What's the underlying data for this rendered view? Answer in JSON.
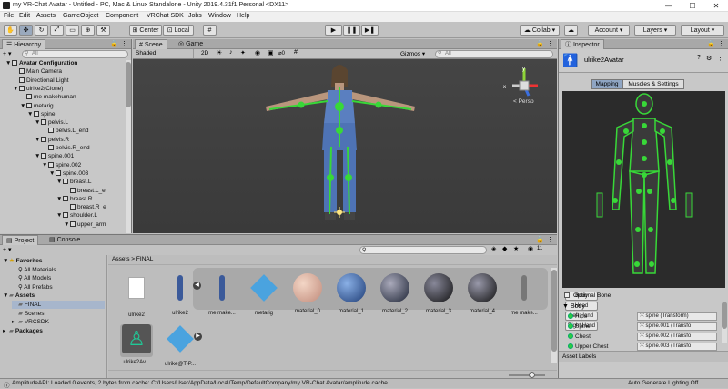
{
  "window": {
    "title": "my VR-Chat Avatar - Untitled - PC, Mac & Linux Standalone - Unity 2019.4.31f1 Personal <DX11>",
    "min": "—",
    "max": "☐",
    "close": "✕"
  },
  "menu": [
    "File",
    "Edit",
    "Assets",
    "GameObject",
    "Component",
    "VRChat SDK",
    "Jobs",
    "Window",
    "Help"
  ],
  "toolbar": {
    "center": "Center",
    "local": "Local",
    "collab": "Collab ▾",
    "account": "Account ▾",
    "layers": "Layers ▾",
    "layout": "Layout ▾"
  },
  "hierarchy": {
    "tab": "Hierarchy",
    "search_placeholder": "All",
    "add": "+ ▾",
    "items": [
      {
        "label": "Avatar Configuration",
        "depth": 0,
        "arrow": "▼",
        "bold": true
      },
      {
        "label": "Main Camera",
        "depth": 1,
        "arrow": ""
      },
      {
        "label": "Directional Light",
        "depth": 1,
        "arrow": ""
      },
      {
        "label": "ulrike2(Clone)",
        "depth": 1,
        "arrow": "▼"
      },
      {
        "label": "me makehuman",
        "depth": 2,
        "arrow": ""
      },
      {
        "label": "metarig",
        "depth": 2,
        "arrow": "▼"
      },
      {
        "label": "spine",
        "depth": 3,
        "arrow": "▼"
      },
      {
        "label": "pelvis.L",
        "depth": 4,
        "arrow": "▼"
      },
      {
        "label": "pelvis.L_end",
        "depth": 5,
        "arrow": ""
      },
      {
        "label": "pelvis.R",
        "depth": 4,
        "arrow": "▼"
      },
      {
        "label": "pelvis.R_end",
        "depth": 5,
        "arrow": ""
      },
      {
        "label": "spine.001",
        "depth": 4,
        "arrow": "▼"
      },
      {
        "label": "spine.002",
        "depth": 5,
        "arrow": "▼"
      },
      {
        "label": "spine.003",
        "depth": 6,
        "arrow": "▼"
      },
      {
        "label": "breast.L",
        "depth": 7,
        "arrow": "▼"
      },
      {
        "label": "breast.L_e",
        "depth": 8,
        "arrow": ""
      },
      {
        "label": "breast.R",
        "depth": 7,
        "arrow": "▼"
      },
      {
        "label": "breast.R_e",
        "depth": 8,
        "arrow": ""
      },
      {
        "label": "shoulder.L",
        "depth": 7,
        "arrow": "▼"
      },
      {
        "label": "upper_arm",
        "depth": 8,
        "arrow": "▼"
      }
    ]
  },
  "scene": {
    "tab_scene": "Scene",
    "tab_game": "Game",
    "shading": "Shaded",
    "mode": "2D",
    "gizmos": "Gizmos ▾",
    "search": "All",
    "persp": "< Persp"
  },
  "project": {
    "tab_project": "Project",
    "tab_console": "Console",
    "add": "+ ▾",
    "breadcrumb": "Assets > FINAL",
    "count": "11",
    "tree": [
      {
        "label": "Favorites",
        "depth": 0,
        "arrow": "▼",
        "star": true
      },
      {
        "label": "All Materials",
        "depth": 1
      },
      {
        "label": "All Models",
        "depth": 1
      },
      {
        "label": "All Prefabs",
        "depth": 1
      },
      {
        "label": "Assets",
        "depth": 0,
        "arrow": "▼"
      },
      {
        "label": "FINAL",
        "depth": 1,
        "selected": true
      },
      {
        "label": "Scenes",
        "depth": 1
      },
      {
        "label": "VRCSDK",
        "depth": 1,
        "arrow": "▸"
      },
      {
        "label": "Packages",
        "depth": 0,
        "arrow": "▸"
      }
    ],
    "assets": [
      {
        "label": "ulrike2",
        "kind": "file"
      },
      {
        "label": "ulrike2",
        "kind": "figure"
      },
      {
        "label": "me make...",
        "kind": "figure"
      },
      {
        "label": "metarig",
        "kind": "box"
      },
      {
        "label": "material_0",
        "kind": "skin"
      },
      {
        "label": "material_1",
        "kind": "blue"
      },
      {
        "label": "material_2",
        "kind": "dark"
      },
      {
        "label": "material_3",
        "kind": "dark2"
      },
      {
        "label": "material_4",
        "kind": "dark3"
      },
      {
        "label": "me make...",
        "kind": "figure2"
      },
      {
        "label": "ulrike2Av...",
        "kind": "avatar"
      },
      {
        "label": "ulrike@T-P...",
        "kind": "box2"
      }
    ]
  },
  "inspector": {
    "tab": "Inspector",
    "title": "ulrike2Avatar",
    "tab_mapping": "Mapping",
    "tab_muscles": "Muscles & Settings",
    "body_buttons": [
      "Body",
      "Head",
      "Left Hand",
      "Right Hand"
    ],
    "optional": "Optional Bone",
    "body_label": "Body",
    "bones": [
      {
        "name": "Hips",
        "field": "spine (Transform)"
      },
      {
        "name": "Spine",
        "field": "spine.001 (Transfo"
      },
      {
        "name": "Chest",
        "field": "spine.002 (Transfo"
      },
      {
        "name": "Upper Chest",
        "field": "spine.003 (Transfo"
      }
    ],
    "asset_labels": "Asset Labels"
  },
  "status": {
    "message": "AmplitudeAPI: Loaded 0 events, 2 bytes from cache: C:/Users/User/AppData/Local/Temp/DefaultCompany/my VR-Chat Avatar/amplitude.cache",
    "lighting": "Auto Generate Lighting Off"
  }
}
